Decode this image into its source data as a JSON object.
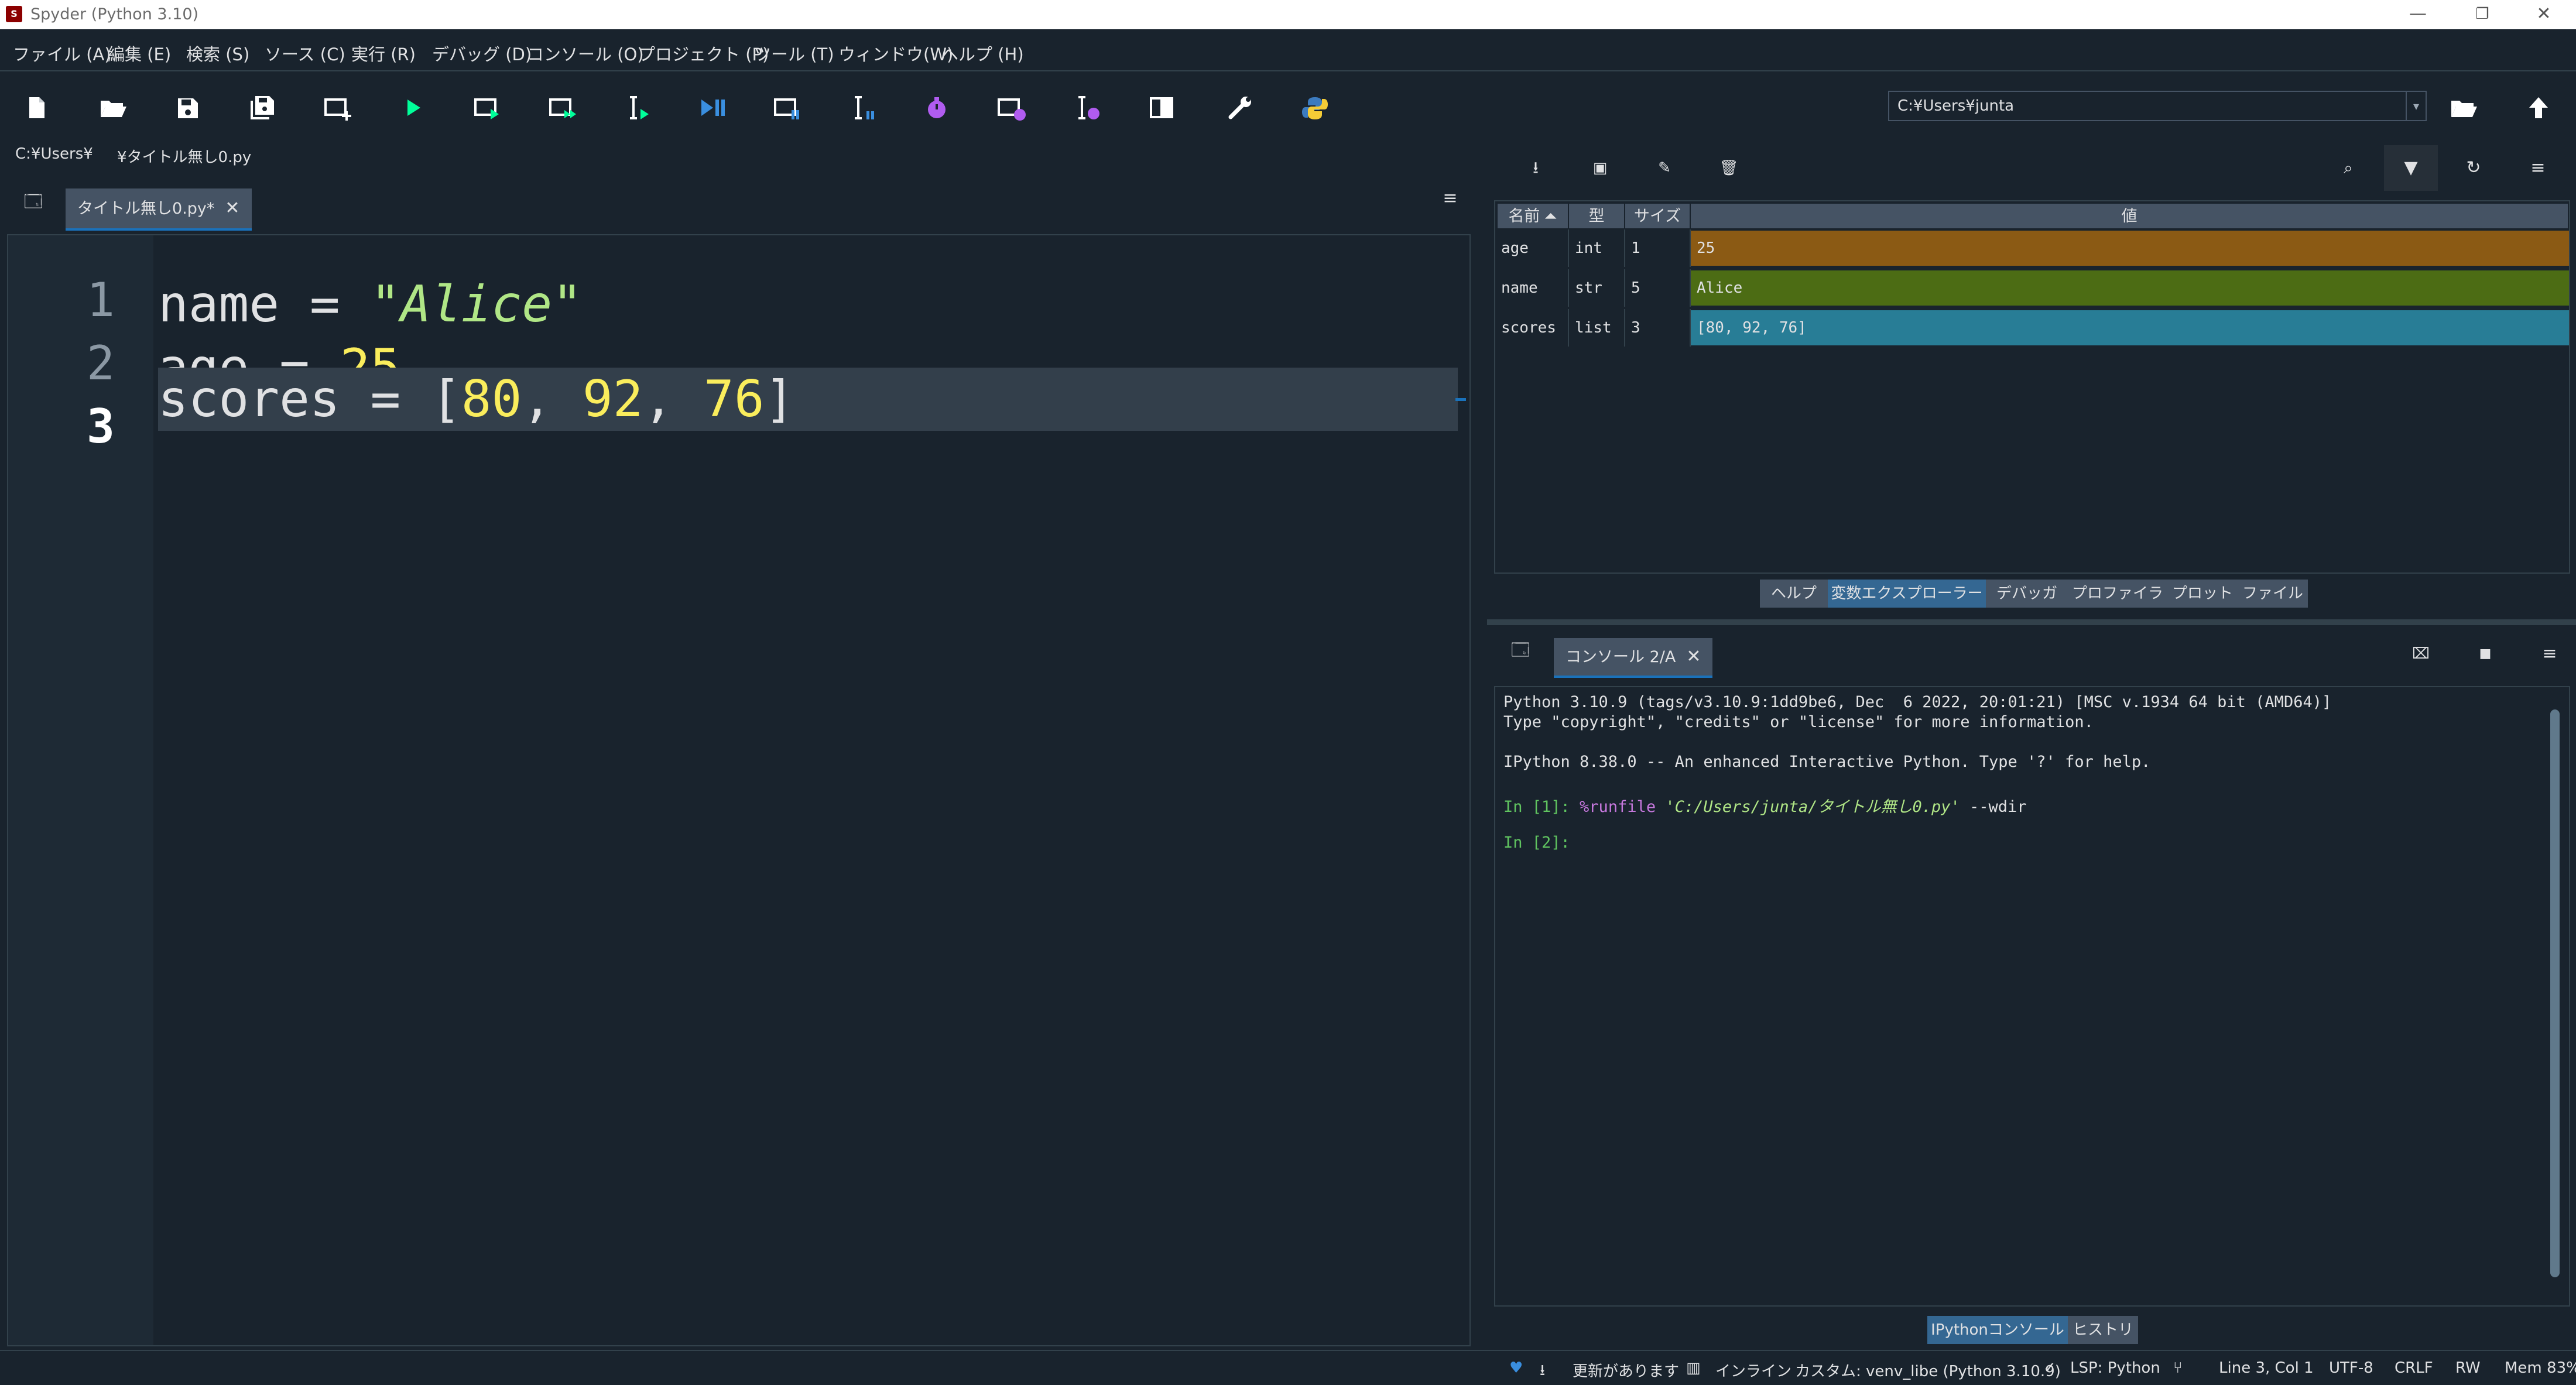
{
  "window": {
    "title": "Spyder (Python 3.10)",
    "controls": {
      "minimize": "—",
      "restore": "❐",
      "close": "✕"
    }
  },
  "menubar": {
    "items": [
      "ファイル (A)",
      "編集 (E)",
      "検索 (S)",
      "ソース (C)",
      "実行 (R)",
      "デバッグ (D)",
      "コンソール (O)",
      "プロジェクト (P)",
      "ツール (T)",
      "ウィンドウ(W)",
      "ヘルプ (H)"
    ]
  },
  "toolbar": {
    "icons": [
      "new-file-icon",
      "open-folder-icon",
      "save-icon",
      "save-all-icon",
      "new-cell-icon",
      "run-icon",
      "run-cell-icon",
      "run-cell-advance-icon",
      "run-selection-icon",
      "debug-icon",
      "debug-cell-icon",
      "debug-selection-icon",
      "profile-icon",
      "profile-cell-icon",
      "profile-selection-icon",
      "maximize-pane-icon",
      "preferences-wrench-icon",
      "python-path-icon"
    ],
    "working_directory": "C:¥Users¥junta"
  },
  "breadcrumb": {
    "root": "C:¥Users¥",
    "file": "¥タイトル無し0.py"
  },
  "editor": {
    "tab_label": "タイトル無し0.py*",
    "lines": [
      {
        "n": "1",
        "var": "name",
        "op": " = ",
        "str": "\"Alice\""
      },
      {
        "n": "2",
        "var": "age",
        "op": " = ",
        "num": "25"
      },
      {
        "n": "3",
        "var": "scores",
        "op": " = ",
        "open": "[",
        "nums": [
          "80",
          "92",
          "76"
        ],
        "sep": ", ",
        "close": "]"
      }
    ]
  },
  "variable_explorer": {
    "headers": {
      "name": "名前",
      "type": "型",
      "size": "サイズ",
      "value": "値"
    },
    "rows": [
      {
        "name": "age",
        "type": "int",
        "size": "1",
        "value": "25",
        "color": "#8b5a14"
      },
      {
        "name": "name",
        "type": "str",
        "size": "5",
        "value": "Alice",
        "color": "#4c6c14"
      },
      {
        "name": "scores",
        "type": "list",
        "size": "3",
        "value": "[80, 92, 76]",
        "color": "#287d96"
      }
    ],
    "pane_tabs": [
      "ヘルプ",
      "変数エクスプローラー",
      "デバッガ",
      "プロファイラ",
      "プロット",
      "ファイル"
    ]
  },
  "console": {
    "tab_label": "コンソール 2/A",
    "lines": {
      "l1": "Python 3.10.9 (tags/v3.10.9:1dd9be6, Dec  6 2022, 20:01:21) [MSC v.1934 64 bit (AMD64)]",
      "l2": "Type \"copyright\", \"credits\" or \"license\" for more information.",
      "l3": "IPython 8.38.0 -- An enhanced Interactive Python. Type '?' for help.",
      "p1": "In [1]: ",
      "magic": "%runfile",
      "path": "'C:/Users/junta/タイトル無し0.py'",
      "rest": " --wdir",
      "p2": "In [2]:"
    },
    "bottom_tabs": [
      "IPythonコンソール",
      "ヒストリ"
    ]
  },
  "statusbar": {
    "update": "更新があります",
    "inline": "インライン",
    "env": "カスタム: venv_libe (Python 3.10.9)",
    "lsp": "LSP: Python",
    "cursor": "Line 3, Col 1",
    "encoding": "UTF-8",
    "eol": "CRLF",
    "rw": "RW",
    "mem": "Mem 83%"
  },
  "colors": {
    "background": "#19232d",
    "accent": "#1a72bb",
    "string": "#b0e686",
    "number": "#faed5c"
  }
}
